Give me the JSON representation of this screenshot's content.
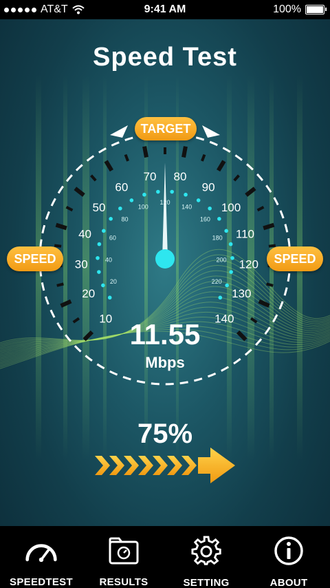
{
  "status_bar": {
    "carrier": "AT&T",
    "time": "9:41 AM",
    "battery": "100%"
  },
  "title": "Speed Test",
  "gauge": {
    "target_label": "TARGET",
    "left_label": "SPEED",
    "right_label": "SPEED",
    "outer_scale": [
      "10",
      "20",
      "30",
      "40",
      "50",
      "60",
      "70",
      "80",
      "90",
      "100",
      "110",
      "120",
      "130",
      "140"
    ],
    "inner_scale": [
      "20",
      "40",
      "60",
      "80",
      "100",
      "120",
      "140",
      "160",
      "180",
      "200",
      "220"
    ],
    "needle_value": 75,
    "scale_max": 140,
    "reading": "11.55",
    "unit": "Mbps"
  },
  "progress": {
    "label": "75%",
    "fraction": 0.75
  },
  "colors": {
    "accent_orange": "#f5a623",
    "cyan": "#2ee6ef",
    "arrow_yellow": "#f6b41c"
  },
  "tabs": [
    {
      "label": "SPEEDTEST",
      "icon": "speedometer-icon"
    },
    {
      "label": "RESULTS",
      "icon": "folder-results-icon"
    },
    {
      "label": "SETTING",
      "icon": "gear-icon"
    },
    {
      "label": "ABOUT",
      "icon": "info-icon"
    }
  ]
}
